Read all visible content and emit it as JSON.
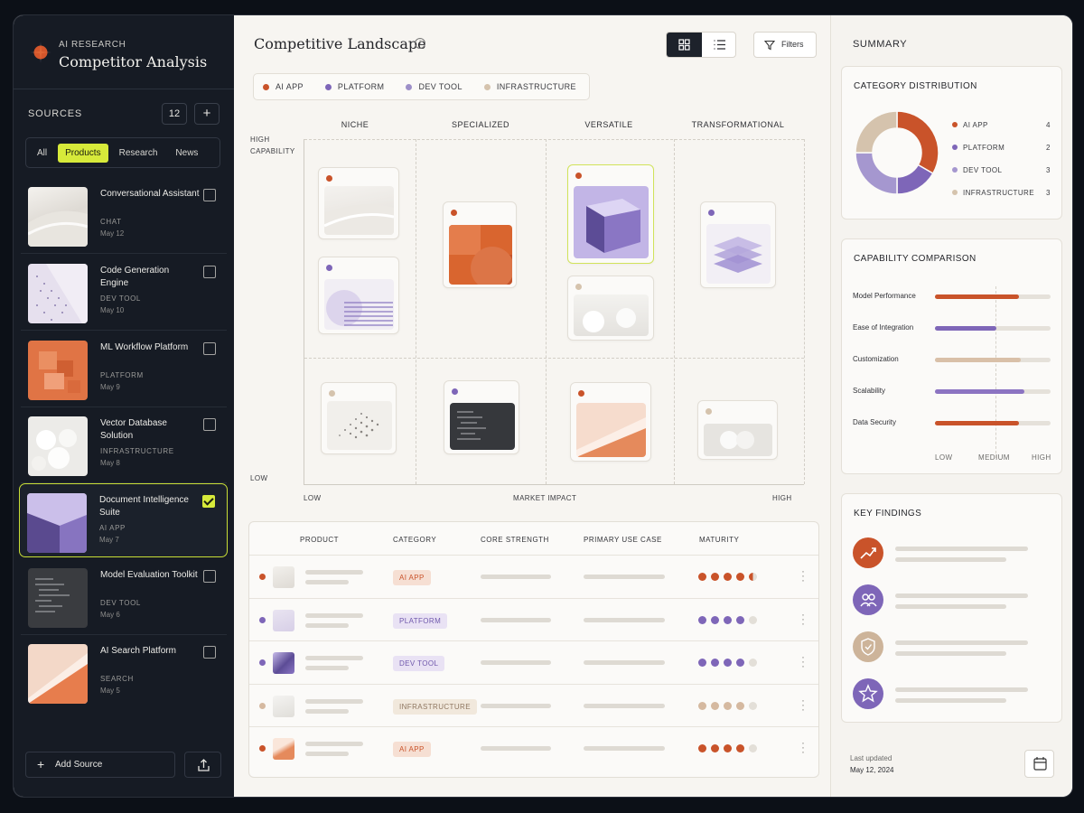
{
  "app": {
    "subtitle": "AI RESEARCH",
    "title": "Competitor Analysis"
  },
  "sources": {
    "label": "SOURCES",
    "count": "12",
    "tabs": [
      "All",
      "Products",
      "Research",
      "News"
    ],
    "active_tab": "Products",
    "items": [
      {
        "name": "Conversational Assistant",
        "category": "CHAT",
        "date": "May 12",
        "checked": false
      },
      {
        "name": "Code Generation Engine",
        "category": "DEV TOOL",
        "date": "May 10",
        "checked": false
      },
      {
        "name": "ML Workflow Platform",
        "category": "PLATFORM",
        "date": "May 9",
        "checked": false
      },
      {
        "name": "Vector Database Solution",
        "category": "INFRASTRUCTURE",
        "date": "May 8",
        "checked": false
      },
      {
        "name": "Document Intelligence Suite",
        "category": "AI APP",
        "date": "May 7",
        "checked": true
      },
      {
        "name": "Model Evaluation Toolkit",
        "category": "DEV TOOL",
        "date": "May 6",
        "checked": false
      },
      {
        "name": "AI Search Platform",
        "category": "SEARCH",
        "date": "May 5",
        "checked": false
      }
    ],
    "add_label": "Add Source"
  },
  "main": {
    "title": "Competitive Landscape",
    "filters_label": "Filters",
    "legend": [
      {
        "label": "AI APP",
        "color": "#c9532a"
      },
      {
        "label": "PLATFORM",
        "color": "#7e66b8"
      },
      {
        "label": "DEV TOOL",
        "color": "#9d8fc8"
      },
      {
        "label": "INFRASTRUCTURE",
        "color": "#d5c3ad"
      }
    ],
    "columns": [
      "NICHE",
      "SPECIALIZED",
      "VERSATILE",
      "TRANSFORMATIONAL"
    ],
    "y_high": "HIGH CAPABILITY",
    "y_low": "LOW",
    "x_low": "LOW",
    "x_mid": "MARKET IMPACT",
    "x_high": "HIGH"
  },
  "table": {
    "headers": [
      "PRODUCT",
      "CATEGORY",
      "CORE STRENGTH",
      "PRIMARY USE CASE",
      "MATURITY"
    ],
    "rows": [
      {
        "category": "AI APP",
        "maturity": 4.5
      },
      {
        "category": "PLATFORM",
        "maturity": 4
      },
      {
        "category": "DEV TOOL",
        "maturity": 4
      },
      {
        "category": "INFRASTRUCTURE",
        "maturity": 4
      },
      {
        "category": "AI APP",
        "maturity": 4
      }
    ],
    "maturity_max": 5
  },
  "summary": {
    "title": "SUMMARY",
    "distribution": {
      "title": "CATEGORY DISTRIBUTION",
      "items": [
        {
          "label": "AI APP",
          "value": "4",
          "color": "#c9532a"
        },
        {
          "label": "PLATFORM",
          "value": "2",
          "color": "#7e66b8"
        },
        {
          "label": "DEV TOOL",
          "value": "3",
          "color": "#a597cf"
        },
        {
          "label": "INFRASTRUCTURE",
          "value": "3",
          "color": "#d5c3ad"
        }
      ]
    },
    "capability": {
      "title": "CAPABILITY COMPARISON",
      "items": [
        {
          "label": "Model Performance",
          "level": 0.73,
          "color": "#c9532a"
        },
        {
          "label": "Ease of Integration",
          "level": 0.53,
          "color": "#7e66b8"
        },
        {
          "label": "Customization",
          "level": 0.74,
          "color": "#d9c0a8"
        },
        {
          "label": "Scalability",
          "level": 0.77,
          "color": "#8c74c2"
        },
        {
          "label": "Data Security",
          "level": 0.73,
          "color": "#c9532a"
        }
      ],
      "scale": [
        "LOW",
        "MEDIUM",
        "HIGH"
      ]
    },
    "findings": {
      "title": "KEY FINDINGS",
      "icons": [
        {
          "name": "trend-up-icon",
          "color": "#c9532a"
        },
        {
          "name": "users-icon",
          "color": "#7e66b8"
        },
        {
          "name": "shield-check-icon",
          "color": "#cdb49a"
        },
        {
          "name": "star-icon",
          "color": "#7e66b8"
        }
      ]
    },
    "updated_label": "Last updated",
    "updated_date": "May 12, 2024"
  }
}
